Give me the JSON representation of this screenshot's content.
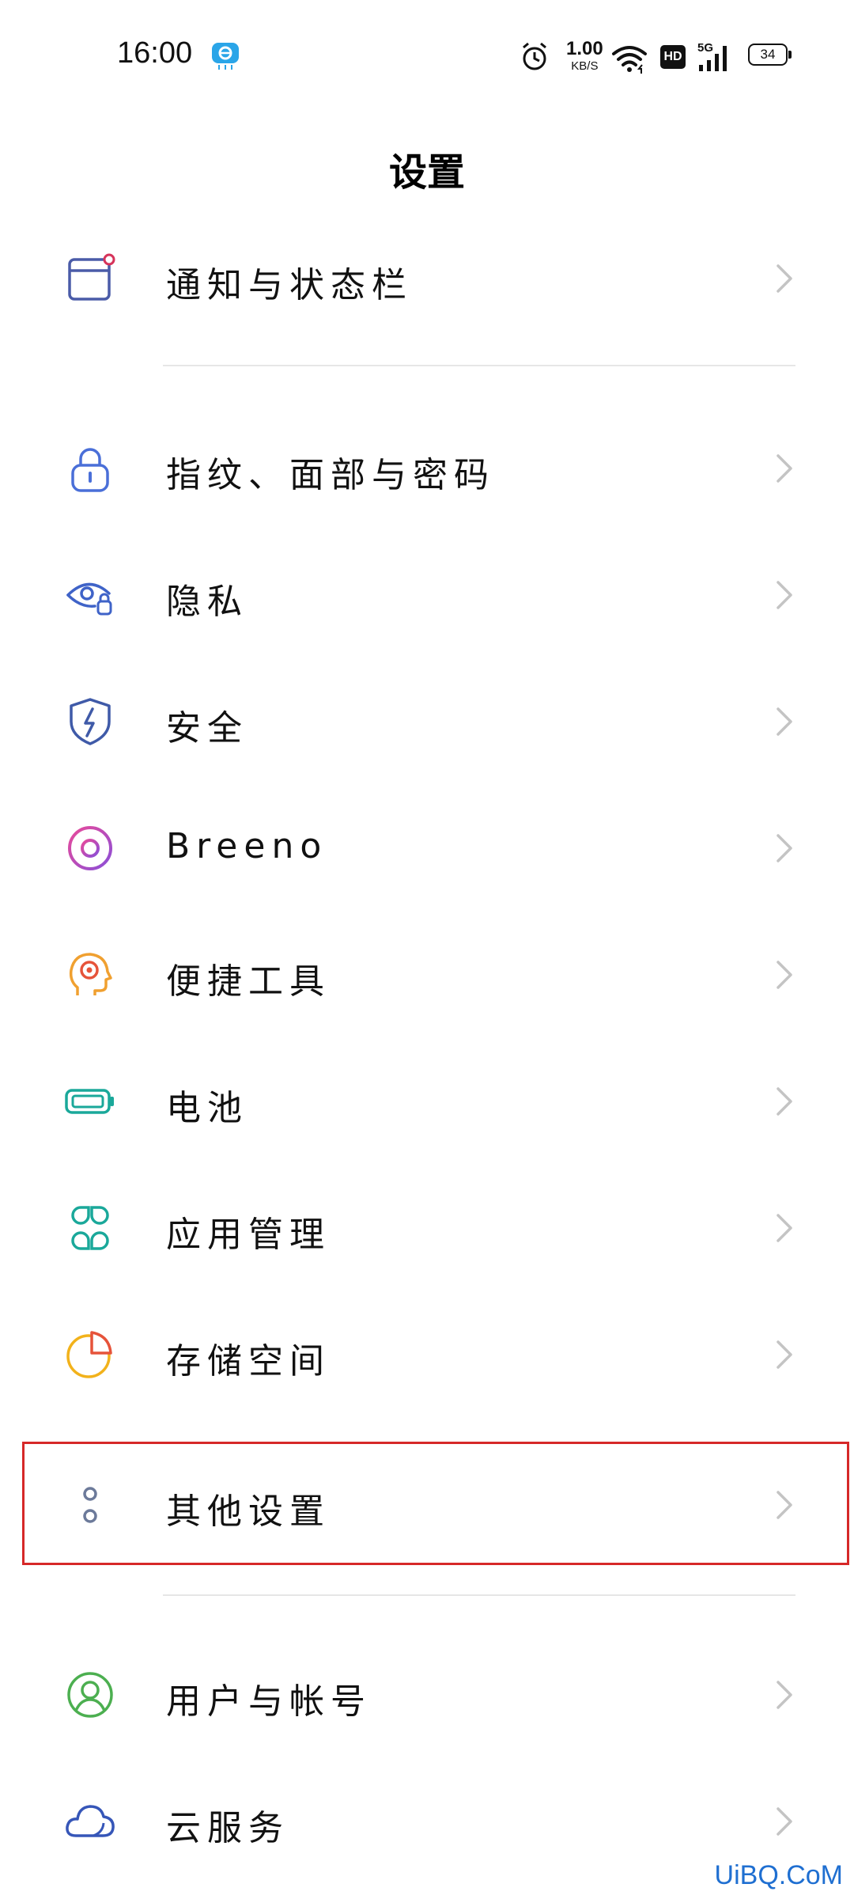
{
  "status_bar": {
    "time": "16:00",
    "speed_value": "1.00",
    "speed_unit": "KB/S",
    "hd": "HD",
    "network": "5G",
    "battery": "34"
  },
  "page": {
    "title": "设置"
  },
  "settings": [
    {
      "label": "通知与状态栏",
      "icon": "notification-panel-icon",
      "color": "#4a5ba8"
    },
    {
      "label": "指纹、面部与密码",
      "icon": "lock-icon",
      "color": "#4a6fd8"
    },
    {
      "label": "隐私",
      "icon": "privacy-eye-lock-icon",
      "color": "#3f63c8"
    },
    {
      "label": "安全",
      "icon": "shield-icon",
      "color": "#3f5aa8"
    },
    {
      "label": "Breeno",
      "icon": "breeno-ring-icon",
      "color": "#c24fb8"
    },
    {
      "label": "便捷工具",
      "icon": "head-gear-icon",
      "color": "#f0a030"
    },
    {
      "label": "电池",
      "icon": "battery-icon",
      "color": "#1aa89a"
    },
    {
      "label": "应用管理",
      "icon": "apps-grid-icon",
      "color": "#1aa89a"
    },
    {
      "label": "存储空间",
      "icon": "pie-chart-icon",
      "color": "#f2b21b"
    },
    {
      "label": "其他设置",
      "icon": "more-dots-icon",
      "color": "#6c7a9a"
    },
    {
      "label": "用户与帐号",
      "icon": "user-account-icon",
      "color": "#4caf50"
    },
    {
      "label": "云服务",
      "icon": "cloud-icon",
      "color": "#3656b8"
    }
  ],
  "watermark": "UiBQ.CoM",
  "highlight_color": "#d62828"
}
